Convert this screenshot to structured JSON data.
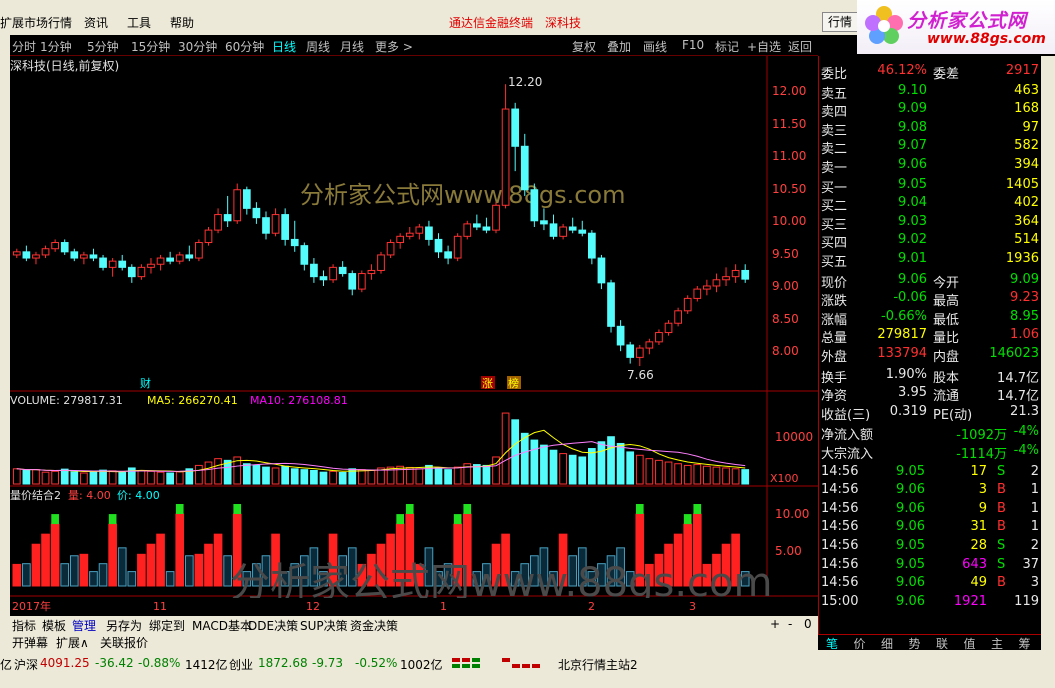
{
  "menu": {
    "app_title": "扩展市场行情",
    "items": [
      "资讯",
      "工具",
      "帮助"
    ],
    "promo1": "通达信金融终端",
    "promo2": "深科技",
    "hq_button": "行情"
  },
  "logo": {
    "line1": "分析家公式网",
    "line2": "www.88gs.com"
  },
  "periods": [
    "分时",
    "1分钟",
    "5分钟",
    "15分钟",
    "30分钟",
    "60分钟",
    "日线",
    "周线",
    "月线",
    "更多 >"
  ],
  "selected_period": "日线",
  "tools": [
    "复权",
    "叠加",
    "画线",
    "F10",
    "标记",
    "+自选",
    "返回"
  ],
  "main_chart": {
    "title": "深科技(日线,前复权)",
    "watermark": "分析家公式网www.88gs.com",
    "high_label": "12.20",
    "low_label": "7.66",
    "markers": [
      "财",
      "涨",
      "榜"
    ],
    "y_ticks": [
      "12.00",
      "11.50",
      "11.00",
      "10.50",
      "10.00",
      "9.50",
      "9.00",
      "8.50",
      "8.00"
    ]
  },
  "volume": {
    "label": "VOLUME: 279817.31",
    "ma5": "MA5: 266270.41",
    "ma10": "MA10: 276108.81",
    "tick": "10000",
    "unit": "X100"
  },
  "indicator": {
    "name": "量价结合2",
    "p1": "量: 4.00",
    "p2": "价: 4.00",
    "ticks": [
      "10.00",
      "5.00"
    ],
    "watermark": "分析家公式网www.88gs.com"
  },
  "x_axis": [
    "2017年",
    "11",
    "12",
    "1",
    "2",
    "3"
  ],
  "chart_data": {
    "type": "candlestick",
    "title": "深科技(日线,前复权)",
    "ylim": [
      7.5,
      12.3
    ],
    "candles": [
      [
        9.45,
        9.55,
        9.4,
        9.5
      ],
      [
        9.5,
        9.6,
        9.35,
        9.4
      ],
      [
        9.4,
        9.5,
        9.3,
        9.45
      ],
      [
        9.45,
        9.6,
        9.4,
        9.55
      ],
      [
        9.55,
        9.7,
        9.5,
        9.65
      ],
      [
        9.65,
        9.7,
        9.45,
        9.5
      ],
      [
        9.5,
        9.55,
        9.35,
        9.4
      ],
      [
        9.4,
        9.5,
        9.3,
        9.45
      ],
      [
        9.45,
        9.55,
        9.35,
        9.4
      ],
      [
        9.4,
        9.45,
        9.2,
        9.25
      ],
      [
        9.25,
        9.4,
        9.1,
        9.35
      ],
      [
        9.35,
        9.45,
        9.2,
        9.25
      ],
      [
        9.25,
        9.3,
        9.0,
        9.1
      ],
      [
        9.1,
        9.3,
        9.05,
        9.25
      ],
      [
        9.25,
        9.4,
        9.15,
        9.3
      ],
      [
        9.3,
        9.45,
        9.2,
        9.4
      ],
      [
        9.4,
        9.5,
        9.3,
        9.35
      ],
      [
        9.35,
        9.5,
        9.3,
        9.45
      ],
      [
        9.45,
        9.6,
        9.35,
        9.4
      ],
      [
        9.4,
        9.7,
        9.35,
        9.65
      ],
      [
        9.65,
        9.9,
        9.6,
        9.85
      ],
      [
        9.85,
        10.2,
        9.8,
        10.1
      ],
      [
        10.1,
        10.4,
        9.9,
        10.0
      ],
      [
        10.0,
        10.6,
        9.95,
        10.5
      ],
      [
        10.5,
        10.55,
        10.1,
        10.2
      ],
      [
        10.2,
        10.3,
        9.95,
        10.05
      ],
      [
        10.05,
        10.15,
        9.7,
        9.8
      ],
      [
        9.8,
        10.2,
        9.75,
        10.1
      ],
      [
        10.1,
        10.2,
        9.6,
        9.7
      ],
      [
        9.7,
        10.0,
        9.5,
        9.6
      ],
      [
        9.6,
        9.65,
        9.2,
        9.3
      ],
      [
        9.3,
        9.4,
        9.0,
        9.1
      ],
      [
        9.1,
        9.2,
        8.95,
        9.05
      ],
      [
        9.05,
        9.3,
        9.0,
        9.25
      ],
      [
        9.25,
        9.35,
        9.1,
        9.15
      ],
      [
        9.15,
        9.2,
        8.8,
        8.9
      ],
      [
        8.9,
        9.2,
        8.85,
        9.15
      ],
      [
        9.15,
        9.3,
        9.05,
        9.2
      ],
      [
        9.2,
        9.5,
        9.15,
        9.45
      ],
      [
        9.45,
        9.7,
        9.4,
        9.65
      ],
      [
        9.65,
        9.8,
        9.55,
        9.75
      ],
      [
        9.75,
        9.9,
        9.7,
        9.8
      ],
      [
        9.8,
        9.95,
        9.7,
        9.9
      ],
      [
        9.9,
        10.0,
        9.6,
        9.7
      ],
      [
        9.7,
        9.8,
        9.4,
        9.5
      ],
      [
        9.5,
        9.6,
        9.3,
        9.4
      ],
      [
        9.4,
        9.8,
        9.35,
        9.75
      ],
      [
        9.75,
        10.0,
        9.7,
        9.95
      ],
      [
        9.95,
        10.1,
        9.85,
        9.9
      ],
      [
        9.9,
        10.05,
        9.8,
        9.85
      ],
      [
        9.85,
        10.3,
        9.8,
        10.25
      ],
      [
        10.25,
        12.2,
        10.2,
        11.8
      ],
      [
        11.8,
        11.9,
        10.8,
        11.2
      ],
      [
        11.2,
        11.4,
        10.4,
        10.5
      ],
      [
        10.5,
        10.6,
        9.9,
        10.0
      ],
      [
        10.0,
        10.2,
        9.85,
        9.95
      ],
      [
        9.95,
        10.1,
        9.7,
        9.75
      ],
      [
        9.75,
        9.95,
        9.7,
        9.9
      ],
      [
        9.9,
        10.05,
        9.8,
        9.85
      ],
      [
        9.85,
        10.0,
        9.75,
        9.8
      ],
      [
        9.8,
        9.85,
        9.3,
        9.4
      ],
      [
        9.4,
        9.45,
        8.9,
        9.0
      ],
      [
        9.0,
        9.05,
        8.2,
        8.3
      ],
      [
        8.3,
        8.4,
        7.9,
        8.0
      ],
      [
        8.0,
        8.05,
        7.7,
        7.8
      ],
      [
        7.8,
        8.0,
        7.66,
        7.95
      ],
      [
        7.95,
        8.1,
        7.85,
        8.05
      ],
      [
        8.05,
        8.25,
        8.0,
        8.2
      ],
      [
        8.2,
        8.4,
        8.15,
        8.35
      ],
      [
        8.35,
        8.6,
        8.3,
        8.55
      ],
      [
        8.55,
        8.8,
        8.5,
        8.75
      ],
      [
        8.75,
        8.95,
        8.7,
        8.9
      ],
      [
        8.9,
        9.05,
        8.8,
        8.95
      ],
      [
        8.95,
        9.15,
        8.85,
        9.05
      ],
      [
        9.05,
        9.25,
        8.95,
        9.1
      ],
      [
        9.1,
        9.3,
        9.0,
        9.2
      ],
      [
        9.2,
        9.3,
        9.0,
        9.06
      ]
    ],
    "volume": [
      90,
      80,
      85,
      70,
      75,
      88,
      72,
      65,
      70,
      82,
      78,
      68,
      95,
      80,
      75,
      70,
      65,
      72,
      90,
      110,
      130,
      150,
      140,
      160,
      120,
      110,
      100,
      95,
      105,
      90,
      85,
      80,
      70,
      75,
      68,
      90,
      85,
      80,
      95,
      100,
      105,
      98,
      90,
      110,
      95,
      85,
      100,
      120,
      115,
      110,
      160,
      420,
      380,
      300,
      260,
      230,
      200,
      180,
      170,
      160,
      210,
      250,
      280,
      240,
      190,
      170,
      150,
      140,
      130,
      120,
      110,
      115,
      105,
      100,
      95,
      90,
      85
    ]
  },
  "quote": {
    "weibi_label": "委比",
    "weibi": "46.12%",
    "weicha_label": "委差",
    "weicha": "2917",
    "asks": [
      [
        "卖五",
        "9.10",
        "463"
      ],
      [
        "卖四",
        "9.09",
        "168"
      ],
      [
        "卖三",
        "9.08",
        "97"
      ],
      [
        "卖二",
        "9.07",
        "582"
      ],
      [
        "卖一",
        "9.06",
        "394"
      ]
    ],
    "bids": [
      [
        "买一",
        "9.05",
        "1405"
      ],
      [
        "买二",
        "9.04",
        "402"
      ],
      [
        "买三",
        "9.03",
        "364"
      ],
      [
        "买四",
        "9.02",
        "514"
      ],
      [
        "买五",
        "9.01",
        "1936"
      ]
    ],
    "stats": [
      [
        "现价",
        "9.06",
        "今开",
        "9.09"
      ],
      [
        "涨跌",
        "-0.06",
        "最高",
        "9.23"
      ],
      [
        "涨幅",
        "-0.66%",
        "最低",
        "8.95"
      ],
      [
        "总量",
        "279817",
        "量比",
        "1.06"
      ],
      [
        "外盘",
        "133794",
        "内盘",
        "146023"
      ]
    ],
    "stats2": [
      [
        "换手",
        "1.90%",
        "股本",
        "14.7亿"
      ],
      [
        "净资",
        "3.95",
        "流通",
        "14.7亿"
      ],
      [
        "收益(三)",
        "0.319",
        "PE(动)",
        "21.3"
      ]
    ],
    "flows": [
      [
        "净流入额",
        "-1092万",
        "-4%"
      ],
      [
        "大宗流入",
        "-1114万",
        "-4%"
      ]
    ],
    "ticks": [
      [
        "14:56",
        "9.05",
        "17",
        "S",
        "2"
      ],
      [
        "14:56",
        "9.06",
        "3",
        "B",
        "1"
      ],
      [
        "14:56",
        "9.06",
        "9",
        "B",
        "1"
      ],
      [
        "14:56",
        "9.06",
        "31",
        "B",
        "1"
      ],
      [
        "14:56",
        "9.05",
        "28",
        "S",
        "2"
      ],
      [
        "14:56",
        "9.05",
        "643",
        "S",
        "37"
      ],
      [
        "14:56",
        "9.06",
        "49",
        "B",
        "3"
      ],
      [
        "15:00",
        "9.06",
        "1921",
        "",
        "119"
      ]
    ]
  },
  "right_tabs": [
    "笔",
    "价",
    "细",
    "势",
    "联",
    "值",
    "主",
    "筹"
  ],
  "bottom_tabs": [
    "指标",
    "模板",
    "管理",
    "另存为",
    "绑定到",
    "MACD基本",
    "DDE决策",
    "SUP决策",
    "资金决策"
  ],
  "bottom_tabs2": [
    "开弹幕",
    "扩展∧",
    "关联报价"
  ],
  "status": {
    "left": "亿",
    "sh": "沪深",
    "sh_val": "4091.25",
    "sh_chg": "-36.42",
    "sh_pct": "-0.88%",
    "sh_amt": "1412亿",
    "cy": "创业",
    "cy_val": "1872.68",
    "cy_chg": "-9.73",
    "cy_pct": "-0.52%",
    "cy_amt": "1002亿",
    "server": "北京行情主站2"
  }
}
